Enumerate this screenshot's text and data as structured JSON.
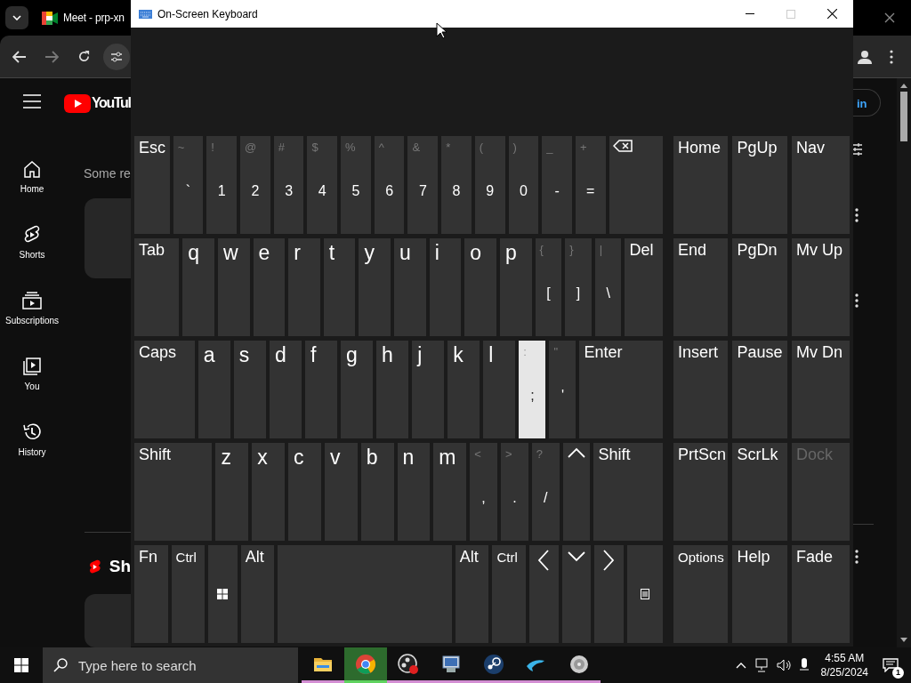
{
  "browser": {
    "tab_title": "Meet - prp-xn",
    "youtube": {
      "logo_text": "YouTul",
      "sign_in": "in",
      "sidebar": [
        {
          "kind": "home",
          "label": "Home"
        },
        {
          "kind": "shorts",
          "label": "Shorts"
        },
        {
          "kind": "subscriptions",
          "label": "Subscriptions"
        },
        {
          "kind": "you",
          "label": "You"
        },
        {
          "kind": "history",
          "label": "History"
        }
      ],
      "heading": "Some re",
      "shorts_heading": "Sh"
    }
  },
  "keyboard_window": {
    "title": "On-Screen Keyboard",
    "maximize_disabled": true,
    "main_rows": [
      [
        {
          "kind": "word",
          "label": "Esc",
          "pressed": false
        },
        {
          "kind": "dual",
          "shift": "~",
          "label": "`",
          "pressed": false
        },
        {
          "kind": "dual",
          "shift": "!",
          "label": "1",
          "pressed": false
        },
        {
          "kind": "dual",
          "shift": "@",
          "label": "2",
          "pressed": false
        },
        {
          "kind": "dual",
          "shift": "#",
          "label": "3",
          "pressed": false
        },
        {
          "kind": "dual",
          "shift": "$",
          "label": "4",
          "pressed": false
        },
        {
          "kind": "dual",
          "shift": "%",
          "label": "5",
          "pressed": false
        },
        {
          "kind": "dual",
          "shift": "^",
          "label": "6",
          "pressed": false
        },
        {
          "kind": "dual",
          "shift": "&",
          "label": "7",
          "pressed": false
        },
        {
          "kind": "dual",
          "shift": "*",
          "label": "8",
          "pressed": false
        },
        {
          "kind": "dual",
          "shift": "(",
          "label": "9",
          "pressed": false
        },
        {
          "kind": "dual",
          "shift": ")",
          "label": "0",
          "pressed": false
        },
        {
          "kind": "dual",
          "shift": "_",
          "label": "-",
          "pressed": false
        },
        {
          "kind": "dual",
          "shift": "+",
          "label": "=",
          "pressed": false
        },
        {
          "kind": "backspace",
          "pressed": false
        }
      ],
      [
        {
          "kind": "word",
          "label": "Tab",
          "pressed": false
        },
        {
          "kind": "letter",
          "label": "q",
          "pressed": false
        },
        {
          "kind": "letter",
          "label": "w",
          "pressed": false
        },
        {
          "kind": "letter",
          "label": "e",
          "pressed": false
        },
        {
          "kind": "letter",
          "label": "r",
          "pressed": false
        },
        {
          "kind": "letter",
          "label": "t",
          "pressed": false
        },
        {
          "kind": "letter",
          "label": "y",
          "pressed": false
        },
        {
          "kind": "letter",
          "label": "u",
          "pressed": false
        },
        {
          "kind": "letter",
          "label": "i",
          "pressed": false
        },
        {
          "kind": "letter",
          "label": "o",
          "pressed": false
        },
        {
          "kind": "letter",
          "label": "p",
          "pressed": false
        },
        {
          "kind": "dual",
          "shift": "{",
          "label": "[",
          "pressed": false
        },
        {
          "kind": "dual",
          "shift": "}",
          "label": "]",
          "pressed": false
        },
        {
          "kind": "dual",
          "shift": "|",
          "label": "\\",
          "pressed": false
        },
        {
          "kind": "word",
          "label": "Del",
          "pressed": false
        }
      ],
      [
        {
          "kind": "word",
          "label": "Caps",
          "pressed": false
        },
        {
          "kind": "letter",
          "label": "a",
          "pressed": false
        },
        {
          "kind": "letter",
          "label": "s",
          "pressed": false
        },
        {
          "kind": "letter",
          "label": "d",
          "pressed": false
        },
        {
          "kind": "letter",
          "label": "f",
          "pressed": false
        },
        {
          "kind": "letter",
          "label": "g",
          "pressed": false
        },
        {
          "kind": "letter",
          "label": "h",
          "pressed": false
        },
        {
          "kind": "letter",
          "label": "j",
          "pressed": false
        },
        {
          "kind": "letter",
          "label": "k",
          "pressed": false
        },
        {
          "kind": "letter",
          "label": "l",
          "pressed": false
        },
        {
          "kind": "dual",
          "shift": ":",
          "label": ";",
          "pressed": true
        },
        {
          "kind": "dual",
          "shift": "\"",
          "label": "'",
          "pressed": false
        },
        {
          "kind": "word",
          "label": "Enter",
          "pressed": false
        }
      ],
      [
        {
          "kind": "word",
          "label": "Shift",
          "pressed": false
        },
        {
          "kind": "letter",
          "label": "z",
          "pressed": false
        },
        {
          "kind": "letter",
          "label": "x",
          "pressed": false
        },
        {
          "kind": "letter",
          "label": "c",
          "pressed": false
        },
        {
          "kind": "letter",
          "label": "v",
          "pressed": false
        },
        {
          "kind": "letter",
          "label": "b",
          "pressed": false
        },
        {
          "kind": "letter",
          "label": "n",
          "pressed": false
        },
        {
          "kind": "letter",
          "label": "m",
          "pressed": false
        },
        {
          "kind": "dual",
          "shift": "<",
          "label": ",",
          "pressed": false
        },
        {
          "kind": "dual",
          "shift": ">",
          "label": ".",
          "pressed": false
        },
        {
          "kind": "dual",
          "shift": "?",
          "label": "/",
          "pressed": false
        },
        {
          "kind": "up",
          "pressed": false
        },
        {
          "kind": "word",
          "label": "Shift",
          "pressed": false
        }
      ],
      [
        {
          "kind": "word",
          "label": "Fn",
          "pressed": false
        },
        {
          "kind": "small",
          "label": "Ctrl",
          "pressed": false
        },
        {
          "kind": "windows",
          "pressed": false
        },
        {
          "kind": "word",
          "label": "Alt",
          "pressed": false
        },
        {
          "kind": "space",
          "pressed": false
        },
        {
          "kind": "word",
          "label": "Alt",
          "pressed": false
        },
        {
          "kind": "small",
          "label": "Ctrl",
          "pressed": false
        },
        {
          "kind": "left",
          "pressed": false
        },
        {
          "kind": "down",
          "pressed": false
        },
        {
          "kind": "right",
          "pressed": false
        },
        {
          "kind": "menu",
          "pressed": false
        }
      ]
    ],
    "side_rows": [
      [
        {
          "kind": "word",
          "label": "Home",
          "disabled": false
        },
        {
          "kind": "word",
          "label": "PgUp",
          "disabled": false
        },
        {
          "kind": "word",
          "label": "Nav",
          "disabled": false
        }
      ],
      [
        {
          "kind": "word",
          "label": "End",
          "disabled": false
        },
        {
          "kind": "word",
          "label": "PgDn",
          "disabled": false
        },
        {
          "kind": "word",
          "label": "Mv Up",
          "disabled": false
        }
      ],
      [
        {
          "kind": "word",
          "label": "Insert",
          "disabled": false
        },
        {
          "kind": "word",
          "label": "Pause",
          "disabled": false
        },
        {
          "kind": "word",
          "label": "Mv Dn",
          "disabled": false
        }
      ],
      [
        {
          "kind": "word",
          "label": "PrtScn",
          "disabled": false
        },
        {
          "kind": "word",
          "label": "ScrLk",
          "disabled": false
        },
        {
          "kind": "word",
          "label": "Dock",
          "disabled": true
        }
      ],
      [
        {
          "kind": "small",
          "label": "Options",
          "disabled": false
        },
        {
          "kind": "word",
          "label": "Help",
          "disabled": false
        },
        {
          "kind": "word",
          "label": "Fade",
          "disabled": false
        }
      ]
    ]
  },
  "taskbar": {
    "search": {
      "placeholder": "Type here to search"
    },
    "apps": [
      {
        "kind": "folder",
        "active": false,
        "running": true
      },
      {
        "kind": "wheel",
        "active": true,
        "running": true
      },
      {
        "kind": "record",
        "active": false,
        "running": true
      },
      {
        "kind": "monitor",
        "active": false,
        "running": true
      },
      {
        "kind": "steam",
        "active": false,
        "running": true
      },
      {
        "kind": "dolphin",
        "active": false,
        "running": true
      },
      {
        "kind": "disc",
        "active": false,
        "running": true
      }
    ],
    "time": "4:55 AM",
    "date": "8/25/2024",
    "notifications": "1"
  }
}
